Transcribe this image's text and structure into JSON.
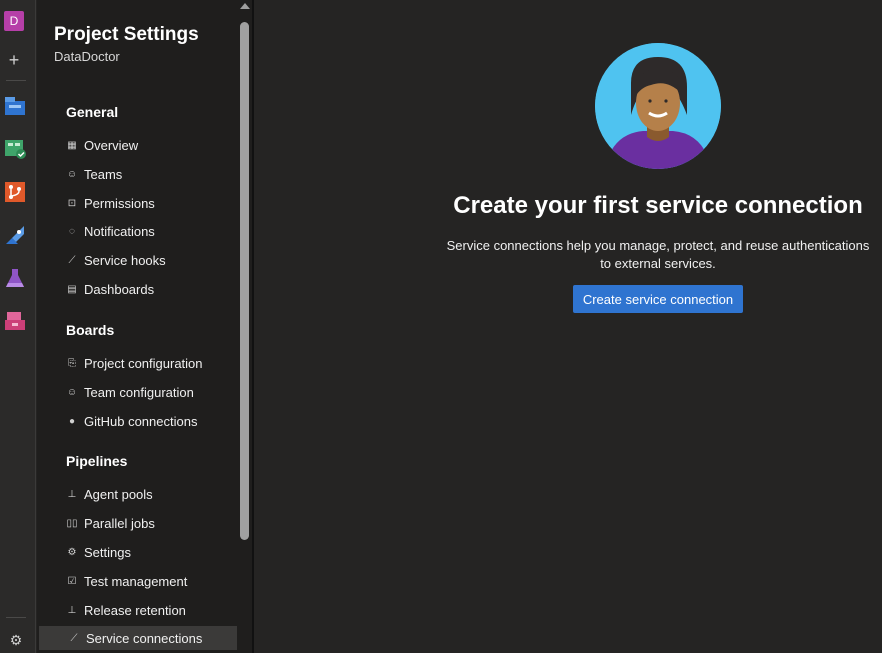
{
  "rail": {
    "org_initial": "D",
    "items": [
      {
        "name": "Overview",
        "icon": "overview-icon",
        "color": "#2f74d0"
      },
      {
        "name": "Boards",
        "icon": "boards-icon",
        "color": "#3fa46a"
      },
      {
        "name": "Repos",
        "icon": "repos-icon",
        "color": "#e0592a"
      },
      {
        "name": "Pipelines",
        "icon": "pipelines-icon",
        "color": "#2f74d0"
      },
      {
        "name": "Test Plans",
        "icon": "test-plans-icon",
        "color": "#8f55c7"
      },
      {
        "name": "Artifacts",
        "icon": "artifacts-icon",
        "color": "#cc3f78"
      }
    ]
  },
  "panel": {
    "title": "Project Settings",
    "subtitle": "DataDoctor",
    "groups": [
      {
        "heading": "General",
        "items": [
          {
            "label": "Overview",
            "icon": "overview-grid-icon"
          },
          {
            "label": "Teams",
            "icon": "teams-icon"
          },
          {
            "label": "Permissions",
            "icon": "lock-icon"
          },
          {
            "label": "Notifications",
            "icon": "chat-icon"
          },
          {
            "label": "Service hooks",
            "icon": "plug-icon"
          },
          {
            "label": "Dashboards",
            "icon": "dashboard-icon"
          }
        ]
      },
      {
        "heading": "Boards",
        "items": [
          {
            "label": "Project configuration",
            "icon": "project-config-icon"
          },
          {
            "label": "Team configuration",
            "icon": "team-config-icon"
          },
          {
            "label": "GitHub connections",
            "icon": "github-icon"
          }
        ]
      },
      {
        "heading": "Pipelines",
        "items": [
          {
            "label": "Agent pools",
            "icon": "agent-pool-icon"
          },
          {
            "label": "Parallel jobs",
            "icon": "parallel-jobs-icon"
          },
          {
            "label": "Settings",
            "icon": "gear-icon"
          },
          {
            "label": "Test management",
            "icon": "test-management-icon"
          },
          {
            "label": "Release retention",
            "icon": "retention-icon"
          },
          {
            "label": "Service connections",
            "icon": "plug-icon",
            "selected": true
          }
        ]
      }
    ]
  },
  "main": {
    "title": "Create your first service connection",
    "description": "Service connections help you manage, protect, and reuse authentications to external services.",
    "cta_label": "Create service connection"
  },
  "colors": {
    "accent": "#2f74d0",
    "background": "#252423",
    "panel": "#1f1e1d"
  }
}
